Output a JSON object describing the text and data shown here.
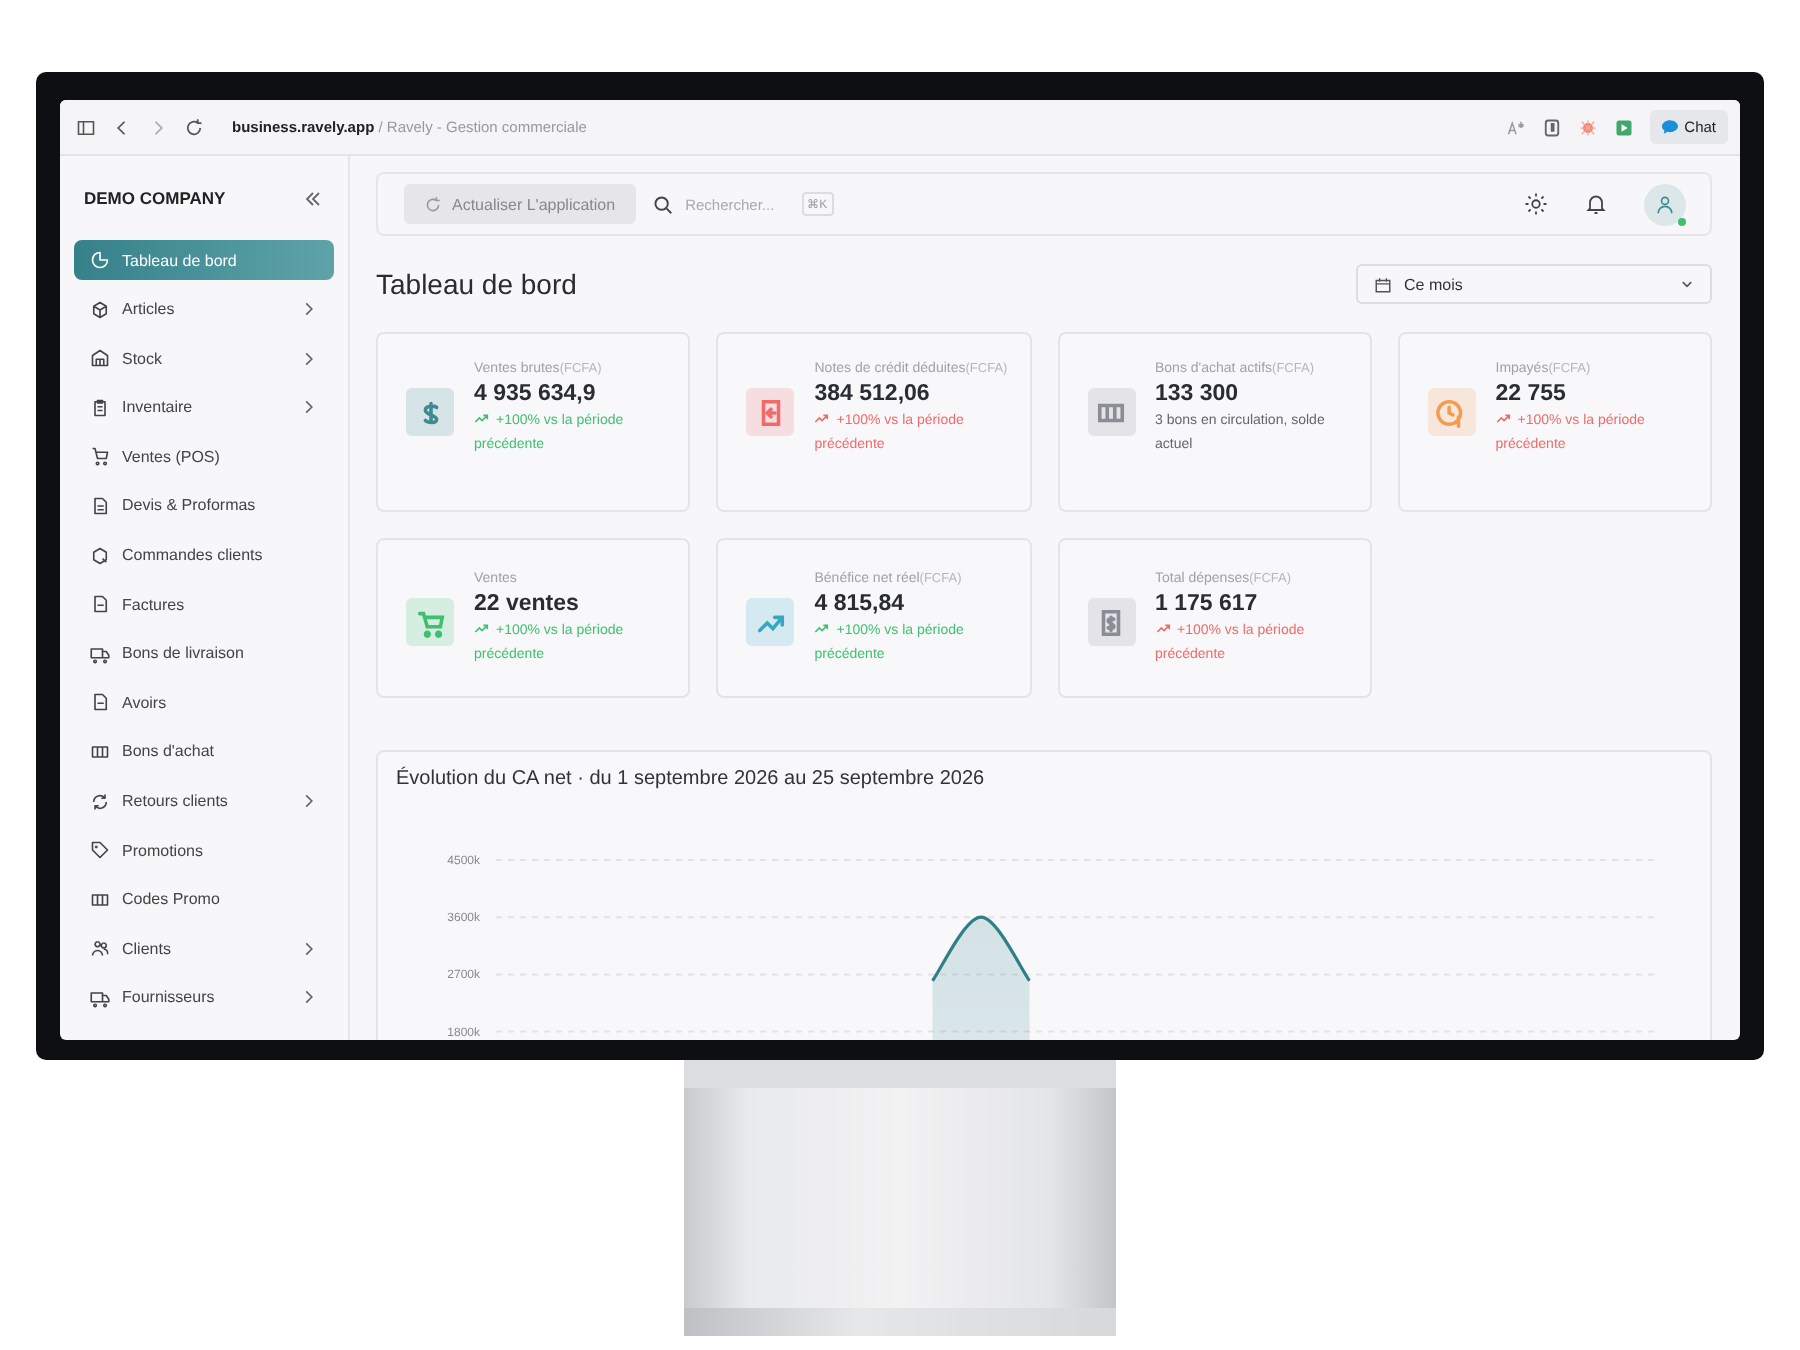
{
  "browser": {
    "url_host": "business.ravely.app",
    "url_rest": " / Ravely - Gestion commerciale",
    "chat_button": "Chat"
  },
  "sidebar": {
    "company": "DEMO COMPANY",
    "items": [
      {
        "label": "Tableau de bord",
        "selected": true,
        "expandable": false
      },
      {
        "label": "Articles",
        "selected": false,
        "expandable": true
      },
      {
        "label": "Stock",
        "selected": false,
        "expandable": true
      },
      {
        "label": "Inventaire",
        "selected": false,
        "expandable": true
      },
      {
        "label": "Ventes (POS)",
        "selected": false,
        "expandable": false
      },
      {
        "label": "Devis & Proformas",
        "selected": false,
        "expandable": false
      },
      {
        "label": "Commandes clients",
        "selected": false,
        "expandable": false
      },
      {
        "label": "Factures",
        "selected": false,
        "expandable": false
      },
      {
        "label": "Bons de livraison",
        "selected": false,
        "expandable": false
      },
      {
        "label": "Avoirs",
        "selected": false,
        "expandable": false
      },
      {
        "label": "Bons d'achat",
        "selected": false,
        "expandable": false
      },
      {
        "label": "Retours clients",
        "selected": false,
        "expandable": true
      },
      {
        "label": "Promotions",
        "selected": false,
        "expandable": false
      },
      {
        "label": "Codes Promo",
        "selected": false,
        "expandable": false
      },
      {
        "label": "Clients",
        "selected": false,
        "expandable": true
      },
      {
        "label": "Fournisseurs",
        "selected": false,
        "expandable": true
      }
    ]
  },
  "header": {
    "refresh_button": "Actualiser L'application",
    "search": {
      "placeholder": "Rechercher..."
    },
    "shortcut": "⌘K"
  },
  "page": {
    "title": "Tableau de bord",
    "period": "Ce mois"
  },
  "cards": [
    {
      "label": "Ventes brutes",
      "unit": "(FCFA)",
      "value": "4 935 634,9",
      "trend": "+100% vs la période précédente",
      "negative": false,
      "color": "#3d8b93"
    },
    {
      "label": "Notes de crédit déduites",
      "unit": "(FCFA)",
      "value": "384 512,06",
      "trend": "+100% vs la période précédente",
      "negative": true,
      "color": "#f06a6a"
    },
    {
      "label": "Bons d'achat actifs",
      "unit": "(FCFA)",
      "value": "133 300",
      "note": "3 bons en circulation, solde actuel",
      "color": "#8a8d96"
    },
    {
      "label": "Impayés",
      "unit": "(FCFA)",
      "value": "22 755",
      "trend": "+100% vs la période précédente",
      "negative": true,
      "color": "#f59a4f"
    },
    {
      "label": "Ventes",
      "value": "22 ventes",
      "trend": "+100% vs la période précédente",
      "negative": false,
      "color": "#3fbf6f"
    },
    {
      "label": "Bénéfice net réel",
      "unit": "(FCFA)",
      "value": "4 815,84",
      "trend": "+100% vs la période précédente",
      "negative": false,
      "color": "#3aa7c2"
    },
    {
      "label": "Total dépenses",
      "unit": "(FCFA)",
      "value": "1 175 617",
      "trend": "+100% vs la période précédente",
      "negative": true,
      "color": "#8a8d96"
    }
  ],
  "chart": {
    "title": "Évolution du CA net · du 1 septembre 2026 au 25 septembre 2026",
    "chart_data": {
      "type": "area",
      "ylim": [
        0,
        4500
      ],
      "grid": true,
      "yticks": [
        {
          "value": 1800,
          "label": "1800k"
        },
        {
          "value": 2700,
          "label": "2700k"
        },
        {
          "value": 3600,
          "label": "3600k"
        },
        {
          "value": 4500,
          "label": "4500k"
        }
      ],
      "series": [
        {
          "color": "#2f7f88",
          "values": [
            null,
            null,
            null,
            null,
            null,
            null,
            null,
            null,
            null,
            2600,
            3600,
            2600,
            null,
            null,
            null,
            null,
            null,
            null,
            null,
            null,
            null,
            null,
            null,
            null,
            null
          ]
        }
      ]
    }
  }
}
